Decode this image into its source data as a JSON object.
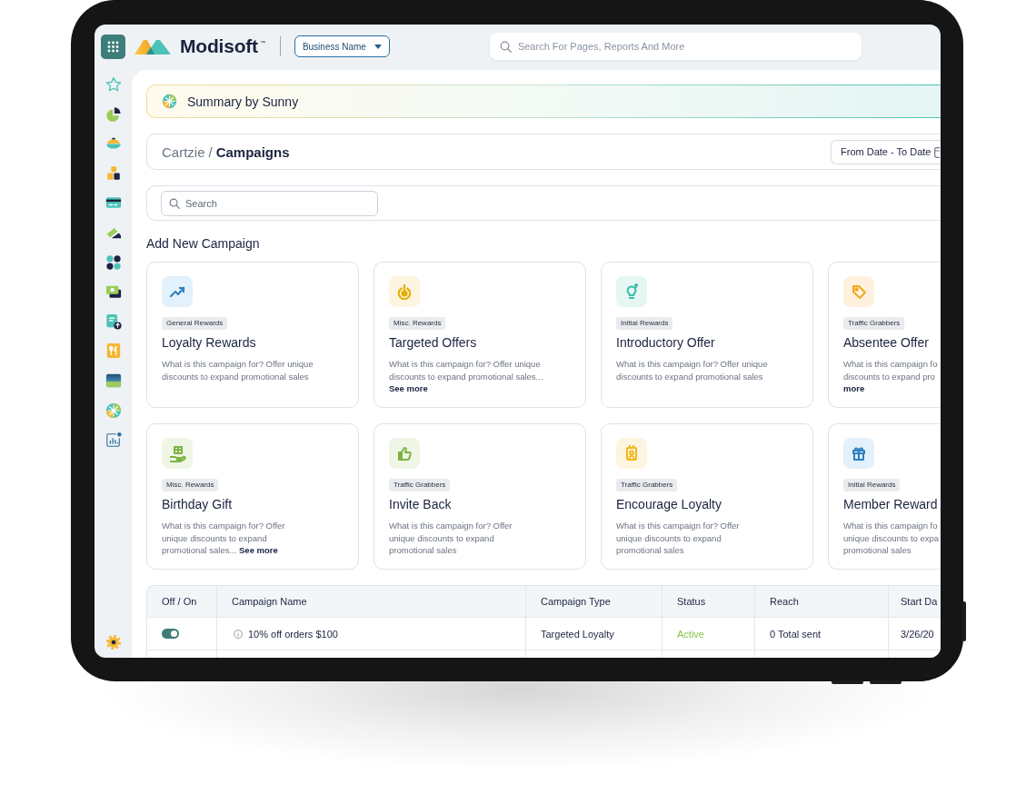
{
  "topbar": {
    "brand": "Modisoft",
    "brand_mark": "™",
    "business": "Business Name",
    "search": {
      "placeholder": "Search For Pages, Reports And More"
    }
  },
  "summary": {
    "title": "Summary by Sunny"
  },
  "breadcrumb": {
    "separator": "/",
    "items": [
      {
        "label": "Cartzie",
        "current": false
      },
      {
        "label": "Campaigns",
        "current": true
      }
    ]
  },
  "date_range": {
    "label": "From Date - To Date"
  },
  "search": {
    "placeholder": "Search"
  },
  "add_campaign": {
    "heading": "Add New Campaign",
    "cards": [
      {
        "tag": "General Rewards",
        "title": "Loyalty Rewards",
        "description": [
          "What is this campaign for? Offer unique",
          "discounts to expand promotional sales"
        ]
      },
      {
        "tag": "Misc. Rewards",
        "title": "Targeted Offers",
        "description": [
          "What is this campaign for? Offer unique",
          "discounts to expand promotional sales..."
        ],
        "link": "See more"
      },
      {
        "tag": "Initial Rewards",
        "title": "Introductory Offer",
        "description": [
          "What is this campaign for? Offer unique",
          "discounts to expand promotional sales"
        ]
      },
      {
        "tag": "Traffic Grabbers",
        "title": "Absentee Offer",
        "description": [
          "What is this campaign fo",
          "discounts to expand pro"
        ],
        "link": "more"
      },
      {
        "tag": "Misc. Rewards",
        "title": "Birthday Gift",
        "description": [
          "What is this campaign for? Offer",
          "unique discounts to expand",
          "promotional sales..."
        ],
        "link": "See more"
      },
      {
        "tag": "Traffic Grabbers",
        "title": "Invite Back",
        "description": [
          "What is this campaign for? Offer",
          "unique discounts to expand",
          "promotional sales"
        ]
      },
      {
        "tag": "Traffic Grabbers",
        "title": "Encourage Loyalty",
        "description": [
          "What is this campaign for? Offer",
          "unique discounts to expand",
          "promotional sales"
        ]
      },
      {
        "tag": "Initial Rewards",
        "title": "Member Reward",
        "description": [
          "What is this campaign fo",
          "unique discounts to expa",
          "promotional sales"
        ]
      }
    ]
  },
  "table": {
    "columns": [
      "Off / On",
      "Campaign Name",
      "Campaign Type",
      "Status",
      "Reach",
      "Start Da"
    ],
    "rows": [
      {
        "on": true,
        "campaign_name": "10% off orders $100",
        "campaign_type": "Targeted Loyalty",
        "status": {
          "label": "Active",
          "color": "#8bc34a"
        },
        "reach": "0 Total sent",
        "column_6": "3/26/20"
      }
    ]
  }
}
